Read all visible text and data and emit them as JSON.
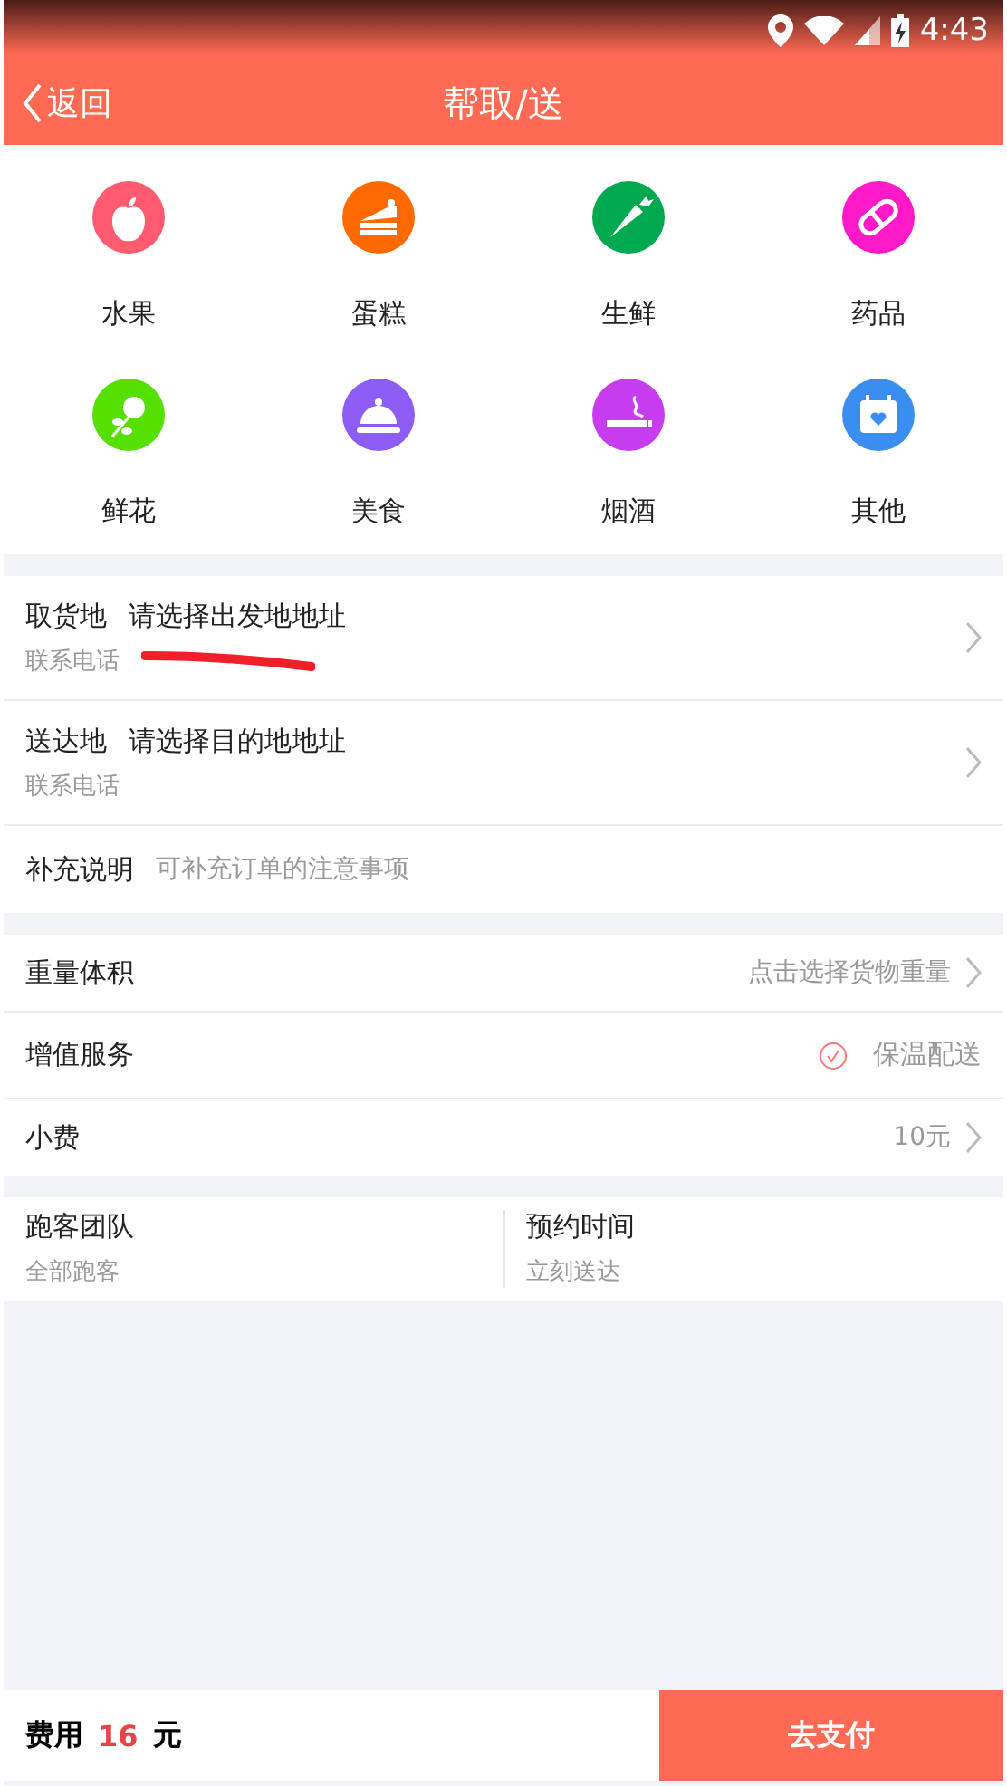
{
  "status_bar": {
    "time": "4:43"
  },
  "header": {
    "back": "返回",
    "title": "帮取/送"
  },
  "categories": [
    {
      "label": "水果",
      "color": "#ff5a6e"
    },
    {
      "label": "蛋糕",
      "color": "#ff6a00"
    },
    {
      "label": "生鲜",
      "color": "#00a84f"
    },
    {
      "label": "药品",
      "color": "#ff19c8"
    },
    {
      "label": "鲜花",
      "color": "#55e000"
    },
    {
      "label": "美食",
      "color": "#8c5cf5"
    },
    {
      "label": "烟酒",
      "color": "#c83cf0"
    },
    {
      "label": "其他",
      "color": "#3a8ef0"
    }
  ],
  "addresses": [
    {
      "label": "取货地",
      "placeholder": "请选择出发地地址",
      "phone_label": "联系电话",
      "redacted": true
    },
    {
      "label": "送达地",
      "placeholder": "请选择目的地地址",
      "phone_label": "联系电话",
      "redacted": false
    }
  ],
  "note": {
    "label": "补充说明",
    "placeholder": "可补充订单的注意事项"
  },
  "options": [
    {
      "kind": "select",
      "label": "重量体积",
      "value": "点击选择货物重量"
    },
    {
      "kind": "check",
      "label": "增值服务",
      "value": "保温配送",
      "checked": true
    },
    {
      "kind": "select",
      "label": "小费",
      "value": "10元"
    }
  ],
  "split": [
    {
      "label": "跑客团队",
      "value": "全部跑客"
    },
    {
      "label": "预约时间",
      "value": "立刻送达"
    }
  ],
  "footer": {
    "fee_label": "费用",
    "fee": "16",
    "unit": "元",
    "pay": "去支付"
  }
}
